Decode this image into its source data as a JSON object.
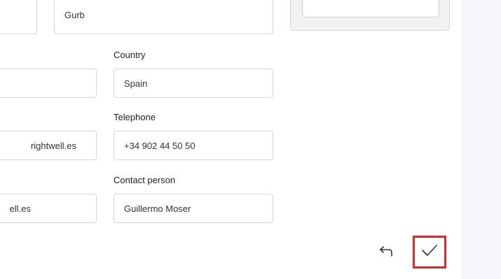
{
  "form": {
    "top_left_field_value": "",
    "top_right_field_value": "Gurb",
    "country": {
      "label": "Country",
      "value": "Spain"
    },
    "left_field_2_value": "",
    "telephone": {
      "label": "Telephone",
      "value": "+34 902 44 50 50"
    },
    "left_field_3_value": "rightwell.es",
    "contact_person": {
      "label": "Contact person",
      "value": "Guillermo Moser"
    },
    "left_field_4_value": "ell.es"
  },
  "actions": {
    "back_icon": "undo-arrow-icon",
    "confirm_icon": "checkmark-icon",
    "confirm_highlight_color": "#d12b2b"
  },
  "colors": {
    "side_panel": "#f4f5fb",
    "field_border": "#d6d6d6"
  }
}
